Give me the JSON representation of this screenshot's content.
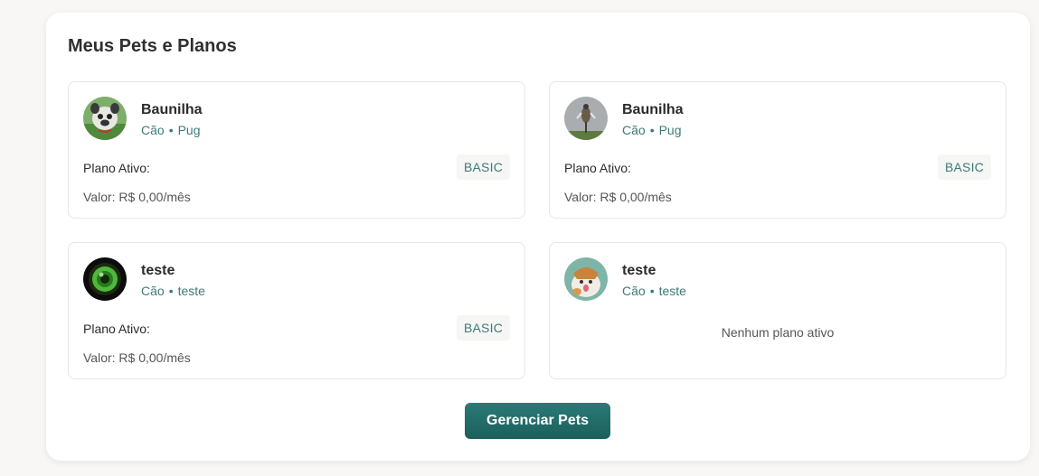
{
  "section": {
    "title": "Meus Pets e Planos"
  },
  "pets": [
    {
      "name": "Baunilha",
      "species": "Cão",
      "separator": "•",
      "breed": "Pug",
      "plan_label": "Plano Ativo:",
      "plan": "BASIC",
      "value": "Valor: R$ 0,00/mês",
      "avatar_icon": "bulldog-photo-avatar"
    },
    {
      "name": "Baunilha",
      "species": "Cão",
      "separator": "•",
      "breed": "Pug",
      "plan_label": "Plano Ativo:",
      "plan": "BASIC",
      "value": "Valor: R$ 0,00/mês",
      "avatar_icon": "bird-photo-avatar"
    },
    {
      "name": "teste",
      "species": "Cão",
      "separator": "•",
      "breed": "teste",
      "plan_label": "Plano Ativo:",
      "plan": "BASIC",
      "value": "Valor: R$ 0,00/mês",
      "avatar_icon": "camera-lens-photo-avatar"
    },
    {
      "name": "teste",
      "species": "Cão",
      "separator": "•",
      "breed": "teste",
      "no_plan": "Nenhum plano ativo",
      "avatar_icon": "cat-photo-avatar"
    }
  ],
  "actions": {
    "manage_label": "Gerenciar Pets"
  },
  "colors": {
    "accent": "#1f6b68",
    "meta_text": "#3d7a78",
    "badge_bg": "#f6f6f4"
  }
}
